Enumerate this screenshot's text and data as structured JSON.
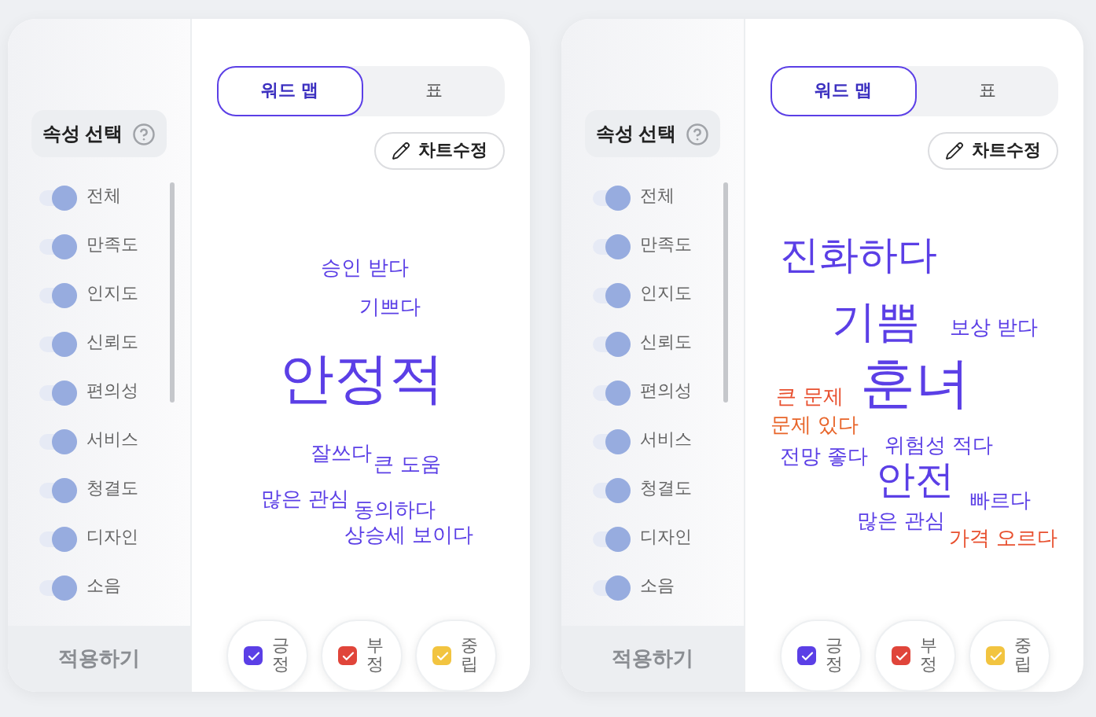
{
  "panels": [
    {
      "sidebar": {
        "title": "속성 선택",
        "attributes": [
          {
            "label": "전체",
            "on": true
          },
          {
            "label": "만족도",
            "on": true
          },
          {
            "label": "인지도",
            "on": true
          },
          {
            "label": "신뢰도",
            "on": true
          },
          {
            "label": "편의성",
            "on": true
          },
          {
            "label": "서비스",
            "on": true
          },
          {
            "label": "청결도",
            "on": true
          },
          {
            "label": "디자인",
            "on": true
          },
          {
            "label": "소음",
            "on": true
          }
        ],
        "apply_button": "적용하기"
      },
      "tabs": [
        {
          "label": "워드 맵",
          "selected": true
        },
        {
          "label": "표",
          "selected": false
        }
      ],
      "edit_button": "차트수정",
      "words": [
        {
          "text": "승인 받다",
          "kind": "sm",
          "color": "#5b3fe6"
        },
        {
          "text": "기쁘다",
          "kind": "sm",
          "color": "#5b3fe6"
        },
        {
          "text": "안정적",
          "kind": "xl",
          "color": "#5b3fe6"
        },
        {
          "text": "잘쓰다",
          "kind": "sm",
          "color": "#5b3fe6"
        },
        {
          "text": "큰 도움",
          "kind": "sm",
          "color": "#5b3fe6"
        },
        {
          "text": "많은 관심",
          "kind": "sm",
          "color": "#5b3fe6"
        },
        {
          "text": "동의하다",
          "kind": "sm",
          "color": "#5b3fe6"
        },
        {
          "text": "상승세 보이다",
          "kind": "sm",
          "color": "#5b3fe6"
        }
      ],
      "legend": [
        {
          "label": "긍정",
          "checked": true,
          "color": "#5b3fe6"
        },
        {
          "label": "부정",
          "checked": true,
          "color": "#e0453a"
        },
        {
          "label": "중립",
          "checked": true,
          "color": "#f2c440"
        }
      ]
    },
    {
      "sidebar": {
        "title": "속성 선택",
        "attributes": [
          {
            "label": "전체",
            "on": true
          },
          {
            "label": "만족도",
            "on": true
          },
          {
            "label": "인지도",
            "on": true
          },
          {
            "label": "신뢰도",
            "on": true
          },
          {
            "label": "편의성",
            "on": true
          },
          {
            "label": "서비스",
            "on": true
          },
          {
            "label": "청결도",
            "on": true
          },
          {
            "label": "디자인",
            "on": true
          },
          {
            "label": "소음",
            "on": true
          }
        ],
        "apply_button": "적용하기"
      },
      "tabs": [
        {
          "label": "워드 맵",
          "selected": true
        },
        {
          "label": "표",
          "selected": false
        }
      ],
      "edit_button": "차트수정",
      "words": [
        {
          "text": "진화하다",
          "kind": "md",
          "color": "#5b3fe6"
        },
        {
          "text": "기쁨",
          "kind": "lg",
          "color": "#5b3fe6"
        },
        {
          "text": "보상 받다",
          "kind": "sm",
          "color": "#5b3fe6"
        },
        {
          "text": "큰 문제",
          "kind": "sm",
          "color": "#e8502f"
        },
        {
          "text": "훈녀",
          "kind": "xl",
          "color": "#5b3fe6"
        },
        {
          "text": "문제 있다",
          "kind": "sm",
          "color": "#e8652a"
        },
        {
          "text": "위험성 적다",
          "kind": "sm",
          "color": "#5b3fe6"
        },
        {
          "text": "전망 좋다",
          "kind": "sm",
          "color": "#5b3fe6"
        },
        {
          "text": "안전",
          "kind": "md",
          "color": "#5b3fe6"
        },
        {
          "text": "빠르다",
          "kind": "sm",
          "color": "#5b3fe6"
        },
        {
          "text": "많은 관심",
          "kind": "sm",
          "color": "#5b3fe6"
        },
        {
          "text": "가격 오르다",
          "kind": "sm",
          "color": "#e8502f"
        }
      ],
      "legend": [
        {
          "label": "긍정",
          "checked": true,
          "color": "#5b3fe6"
        },
        {
          "label": "부정",
          "checked": true,
          "color": "#e0453a"
        },
        {
          "label": "중립",
          "checked": true,
          "color": "#f2c440"
        }
      ]
    }
  ]
}
